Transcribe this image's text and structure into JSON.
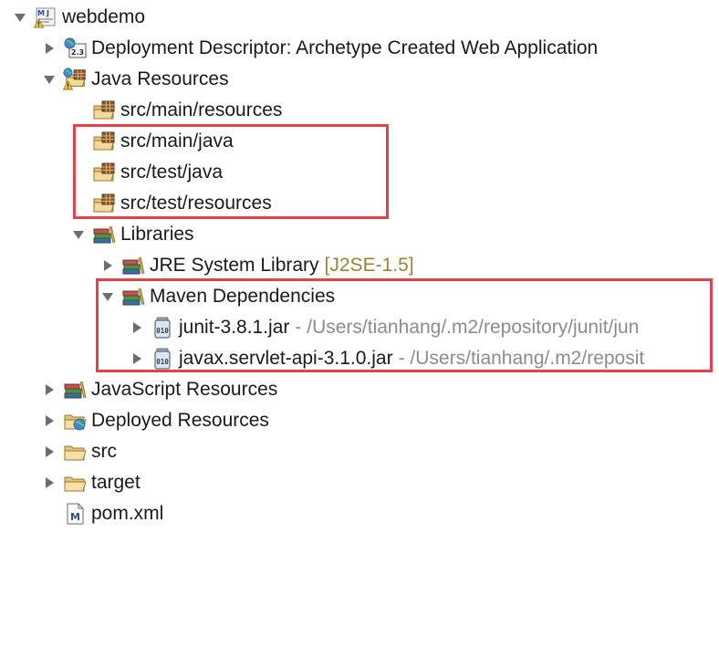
{
  "project": {
    "name": "webdemo",
    "icon": "maven-web-project-icon"
  },
  "deployment_descriptor": {
    "label": "Deployment Descriptor: Archetype Created Web Application",
    "icon": "deployment-descriptor-icon"
  },
  "java_resources": {
    "label": "Java Resources",
    "icon": "java-resources-warning-icon",
    "folders": [
      {
        "label": "src/main/resources",
        "icon": "package-folder-icon"
      },
      {
        "label": "src/main/java",
        "icon": "package-folder-icon"
      },
      {
        "label": "src/test/java",
        "icon": "package-folder-icon"
      },
      {
        "label": "src/test/resources",
        "icon": "package-folder-icon"
      }
    ],
    "libraries": {
      "label": "Libraries",
      "icon": "library-icon",
      "jre": {
        "label": "JRE System Library",
        "version": "[J2SE-1.5]",
        "icon": "library-icon"
      },
      "maven": {
        "label": "Maven Dependencies",
        "icon": "library-icon",
        "jars": [
          {
            "label": "junit-3.8.1.jar",
            "path": "- /Users/tianhang/.m2/repository/junit/jun",
            "icon": "jar-icon"
          },
          {
            "label": "javax.servlet-api-3.1.0.jar",
            "path": "- /Users/tianhang/.m2/reposit",
            "icon": "jar-icon"
          }
        ]
      }
    }
  },
  "javascript_resources": {
    "label": "JavaScript Resources",
    "icon": "library-icon"
  },
  "deployed_resources": {
    "label": "Deployed Resources",
    "icon": "deployed-resources-icon"
  },
  "src": {
    "label": "src",
    "icon": "folder-icon"
  },
  "target": {
    "label": "target",
    "icon": "folder-icon"
  },
  "pom": {
    "label": "pom.xml",
    "icon": "maven-pom-file-icon"
  },
  "colors": {
    "highlight": "#e8404a",
    "path_text": "#8c8c8c",
    "jre_version": "#9a8236"
  }
}
